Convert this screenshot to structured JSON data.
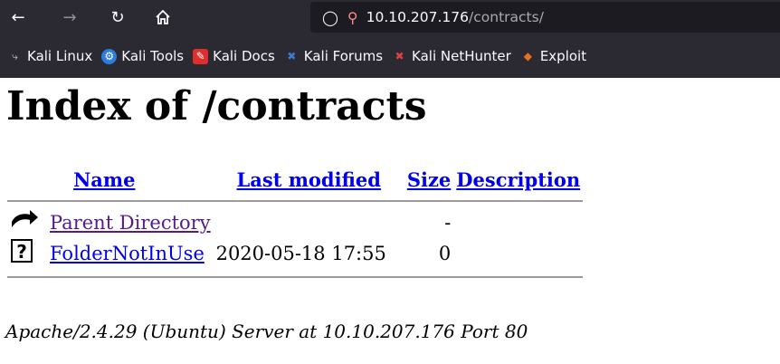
{
  "browser": {
    "url_host": "10.10.207.176",
    "url_path": "/contracts/",
    "bookmarks": [
      {
        "label": "Kali Linux",
        "icon": "kali-dragon-icon",
        "color": "#4a90d9"
      },
      {
        "label": "Kali Tools",
        "icon": "kali-tools-icon",
        "color": "#2d7de0"
      },
      {
        "label": "Kali Docs",
        "icon": "kali-docs-icon",
        "color": "#e02d2d"
      },
      {
        "label": "Kali Forums",
        "icon": "kali-forums-icon",
        "color": "#3d7bd9"
      },
      {
        "label": "Kali NetHunter",
        "icon": "kali-nethunter-icon",
        "color": "#e04040"
      },
      {
        "label": "Exploit",
        "icon": "exploit-db-icon",
        "color": "#e8721c"
      }
    ]
  },
  "page": {
    "title": "Index of /contracts",
    "columns": {
      "name": "Name",
      "last_modified": "Last modified",
      "size": "Size",
      "description": "Description"
    },
    "rows": [
      {
        "name": "Parent Directory",
        "modified": "",
        "size": "-",
        "icon": "back-arrow-icon"
      },
      {
        "name": "FolderNotInUse",
        "modified": "2020-05-18 17:55",
        "size": "0",
        "icon": "unknown-file-icon"
      }
    ],
    "footer": "Apache/2.4.29 (Ubuntu) Server at 10.10.207.176 Port 80"
  }
}
